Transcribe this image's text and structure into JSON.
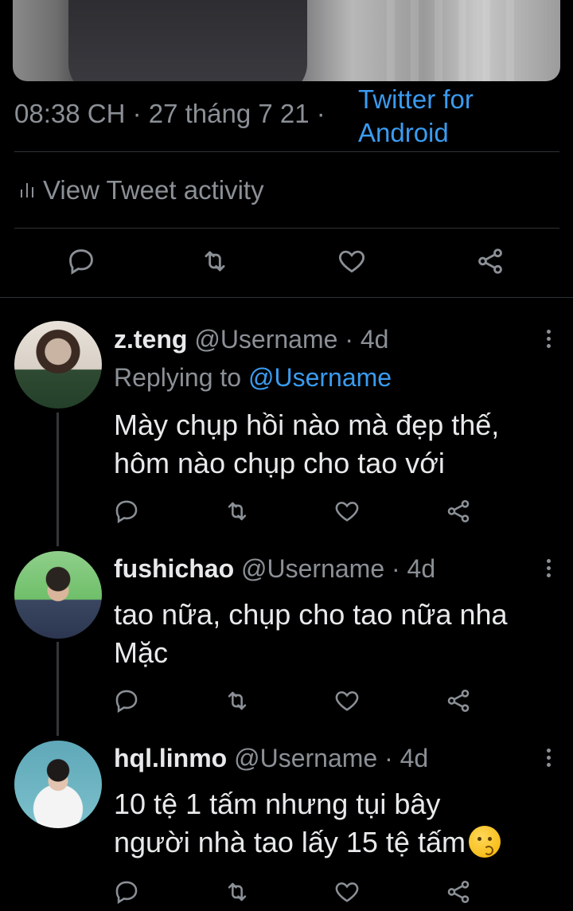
{
  "tweet": {
    "time": "08:38 CH · 27 tháng 7 21 ·",
    "source": "Twitter for Android",
    "activity_label": "View Tweet activity"
  },
  "replies": [
    {
      "name": "z.teng",
      "handle": "@Username · 4d",
      "replying_prefix": "Replying to ",
      "replying_mention": "@Username",
      "text_line1": "Mày chụp hồi nào mà đẹp thế,",
      "text_line2": "hôm nào chụp cho tao với"
    },
    {
      "name": "fushichao",
      "handle": "@Username · 4d",
      "text_line1": "tao nữa, chụp cho tao nữa nha",
      "text_line2": "Mặc"
    },
    {
      "name": "hql.linmo",
      "handle": "@Username · 4d",
      "text_line1": "10 tệ 1 tấm nhưng tụi bây",
      "text_line2": "người nhà tao lấy 15 tệ  tấm",
      "emoji": "kissing-face-emoji"
    }
  ],
  "icons": {
    "reply": "reply-icon",
    "retweet": "retweet-icon",
    "like": "like-icon",
    "share": "share-icon",
    "more": "more-icon"
  },
  "colors": {
    "background": "#000000",
    "text": "#e7e9ea",
    "secondary": "#8b9096",
    "accent": "#3a9bf0",
    "divider": "#2f3336"
  }
}
